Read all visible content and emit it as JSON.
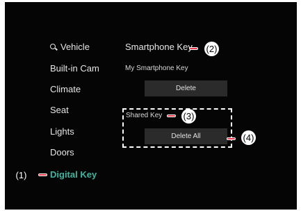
{
  "sidebar": {
    "items": [
      {
        "label": "Vehicle",
        "icon": "search-icon"
      },
      {
        "label": "Built-in Cam"
      },
      {
        "label": "Climate"
      },
      {
        "label": "Seat"
      },
      {
        "label": "Lights"
      },
      {
        "label": "Doors"
      },
      {
        "label": "Digital Key",
        "active": true
      }
    ]
  },
  "main": {
    "smartphone_key_title": "Smartphone Key",
    "my_key_label": "My Smartphone Key",
    "delete_label": "Delete",
    "shared_key_label": "Shared Key",
    "delete_all_label": "Delete All"
  },
  "callouts": {
    "c1": "(1)",
    "c2": "(2)",
    "c3": "(3)",
    "c4": "(4)"
  },
  "colors": {
    "active": "#3fb6a0",
    "callout_dash": "#e83a4a"
  }
}
